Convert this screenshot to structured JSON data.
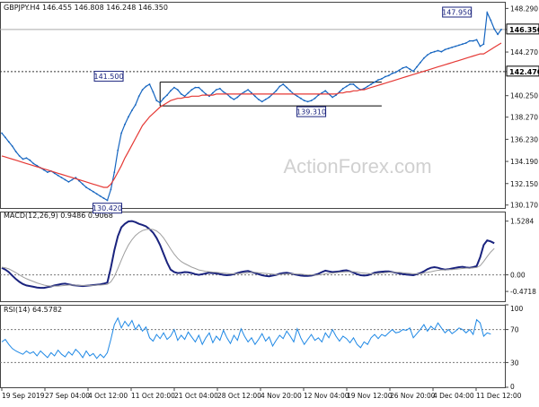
{
  "chart_data": [
    {
      "type": "line",
      "panel": "price",
      "header": "GBPJPY.H4  146.455 146.808 146.248 146.350",
      "x_ticks": [
        "19 Sep 2019",
        "27 Sep 04:00",
        "4 Oct 12:00",
        "11 Oct 20:00",
        "21 Oct 04:00",
        "28 Oct 12:00",
        "4 Nov 20:00",
        "12 Nov 04:00",
        "19 Nov 12:00",
        "26 Nov 20:00",
        "4 Dec 04:00",
        "11 Dec 12:00"
      ],
      "y_ticks": [
        130.17,
        132.15,
        134.19,
        136.23,
        138.27,
        140.25,
        142.47,
        144.27,
        146.35,
        148.29
      ],
      "ylim": [
        129.9,
        148.9
      ],
      "grid": false,
      "watermark": "ActionForex.com",
      "annotations": [
        {
          "text": "141.500",
          "x_index": 35,
          "value": 141.5
        },
        {
          "text": "130.420",
          "x_index": 30,
          "value": 130.42
        },
        {
          "text": "139.310",
          "x_index": 88,
          "value": 139.31
        },
        {
          "text": "147.950",
          "x_index": 134,
          "value": 147.95
        }
      ],
      "horizontal_lines": [
        {
          "name": "current",
          "value": 146.35,
          "label": "146.350",
          "style": "solid-gray"
        },
        {
          "name": "level",
          "value": 142.47,
          "label": "142.470",
          "style": "dotted"
        }
      ],
      "range_box": {
        "from_index": 45,
        "to_index": 108,
        "top": 141.5,
        "bottom": 139.31
      },
      "series": [
        {
          "name": "price",
          "color": "#1565c0",
          "values": [
            136.8,
            136.4,
            136.0,
            135.6,
            135.1,
            134.7,
            134.4,
            134.5,
            134.3,
            134.0,
            133.8,
            133.6,
            133.4,
            133.2,
            133.3,
            133.1,
            132.9,
            132.7,
            132.5,
            132.3,
            132.5,
            132.7,
            132.4,
            132.1,
            131.8,
            131.6,
            131.4,
            131.2,
            131.0,
            130.8,
            130.6,
            131.6,
            133.2,
            135.2,
            136.8,
            137.6,
            138.3,
            138.9,
            139.4,
            140.2,
            140.8,
            141.1,
            141.3,
            140.6,
            139.8,
            139.6,
            140.0,
            140.3,
            140.7,
            141.0,
            140.8,
            140.4,
            140.2,
            140.5,
            140.8,
            141.0,
            141.0,
            140.7,
            140.4,
            140.2,
            140.5,
            140.8,
            140.9,
            140.6,
            140.4,
            140.1,
            139.9,
            140.1,
            140.4,
            140.6,
            140.8,
            140.5,
            140.2,
            139.9,
            139.7,
            139.9,
            140.1,
            140.4,
            140.7,
            141.1,
            141.3,
            141.0,
            140.7,
            140.4,
            140.2,
            140.0,
            139.8,
            139.7,
            139.8,
            140.0,
            140.3,
            140.5,
            140.7,
            140.4,
            140.1,
            140.3,
            140.6,
            140.9,
            141.1,
            141.3,
            141.3,
            141.0,
            140.8,
            140.9,
            141.1,
            141.3,
            141.5,
            141.7,
            141.8,
            142.0,
            142.1,
            142.3,
            142.4,
            142.6,
            142.8,
            142.9,
            142.7,
            142.5,
            142.9,
            143.3,
            143.7,
            144.0,
            144.2,
            144.3,
            144.4,
            144.3,
            144.5,
            144.6,
            144.7,
            144.8,
            144.9,
            145.0,
            145.1,
            145.3,
            145.3,
            145.4,
            144.8,
            145.0,
            147.9,
            147.2,
            146.4,
            145.9,
            146.35
          ]
        },
        {
          "name": "sma",
          "color": "#e53935",
          "values": [
            134.7,
            134.6,
            134.5,
            134.4,
            134.3,
            134.2,
            134.1,
            134.0,
            133.9,
            133.8,
            133.7,
            133.6,
            133.5,
            133.4,
            133.3,
            133.2,
            133.1,
            133.0,
            132.9,
            132.8,
            132.7,
            132.6,
            132.5,
            132.4,
            132.3,
            132.2,
            132.1,
            132.0,
            131.9,
            131.8,
            131.8,
            132.1,
            132.6,
            133.2,
            133.8,
            134.5,
            135.1,
            135.7,
            136.3,
            136.9,
            137.5,
            137.9,
            138.3,
            138.6,
            138.9,
            139.2,
            139.4,
            139.6,
            139.8,
            139.9,
            140.0,
            140.0,
            140.1,
            140.1,
            140.2,
            140.2,
            140.2,
            140.3,
            140.3,
            140.3,
            140.3,
            140.4,
            140.4,
            140.4,
            140.4,
            140.4,
            140.4,
            140.4,
            140.4,
            140.4,
            140.4,
            140.4,
            140.4,
            140.4,
            140.4,
            140.4,
            140.4,
            140.4,
            140.4,
            140.4,
            140.4,
            140.4,
            140.4,
            140.4,
            140.4,
            140.4,
            140.4,
            140.4,
            140.4,
            140.4,
            140.4,
            140.4,
            140.4,
            140.4,
            140.4,
            140.4,
            140.5,
            140.5,
            140.6,
            140.6,
            140.7,
            140.7,
            140.8,
            140.8,
            140.9,
            141.0,
            141.1,
            141.2,
            141.3,
            141.4,
            141.5,
            141.6,
            141.7,
            141.8,
            141.9,
            142.0,
            142.1,
            142.2,
            142.3,
            142.4,
            142.5,
            142.6,
            142.7,
            142.8,
            142.9,
            143.0,
            143.1,
            143.2,
            143.3,
            143.4,
            143.5,
            143.6,
            143.7,
            143.8,
            143.9,
            144.0,
            144.1,
            144.1,
            144.3,
            144.5,
            144.7,
            144.9,
            145.1
          ]
        }
      ]
    },
    {
      "type": "line",
      "panel": "macd",
      "header": "MACD(12,26,9) 0.9486 0.9068",
      "y_ticks": [
        1.5284,
        0.0,
        -0.4718
      ],
      "y_tick_labels": [
        "1.5284",
        "0.00",
        "-0.4718"
      ],
      "ylim": [
        -0.75,
        1.8
      ],
      "reference_lines": [
        0.0
      ],
      "grid": false,
      "series": [
        {
          "name": "macd",
          "color": "#1a237e",
          "values": [
            0.2,
            0.15,
            0.08,
            -0.02,
            -0.12,
            -0.2,
            -0.26,
            -0.3,
            -0.32,
            -0.34,
            -0.36,
            -0.37,
            -0.37,
            -0.35,
            -0.33,
            -0.3,
            -0.28,
            -0.26,
            -0.25,
            -0.27,
            -0.29,
            -0.3,
            -0.31,
            -0.32,
            -0.31,
            -0.3,
            -0.29,
            -0.28,
            -0.27,
            -0.25,
            -0.22,
            0.2,
            0.7,
            1.1,
            1.35,
            1.45,
            1.52,
            1.53,
            1.5,
            1.45,
            1.42,
            1.38,
            1.3,
            1.2,
            1.05,
            0.85,
            0.6,
            0.35,
            0.15,
            0.08,
            0.05,
            0.06,
            0.08,
            0.07,
            0.05,
            0.02,
            0.0,
            0.02,
            0.04,
            0.06,
            0.05,
            0.04,
            0.02,
            0.0,
            -0.01,
            0.0,
            0.02,
            0.05,
            0.08,
            0.1,
            0.11,
            0.08,
            0.05,
            0.02,
            -0.01,
            -0.03,
            -0.04,
            -0.02,
            0.0,
            0.03,
            0.05,
            0.06,
            0.04,
            0.02,
            0.0,
            -0.02,
            -0.03,
            -0.03,
            -0.02,
            0.0,
            0.03,
            0.08,
            0.12,
            0.1,
            0.08,
            0.09,
            0.1,
            0.12,
            0.13,
            0.1,
            0.06,
            0.02,
            -0.01,
            -0.02,
            -0.01,
            0.02,
            0.06,
            0.08,
            0.09,
            0.1,
            0.1,
            0.08,
            0.06,
            0.04,
            0.02,
            0.01,
            0.0,
            -0.01,
            0.02,
            0.05,
            0.1,
            0.16,
            0.2,
            0.22,
            0.2,
            0.17,
            0.15,
            0.16,
            0.18,
            0.2,
            0.22,
            0.23,
            0.21,
            0.2,
            0.22,
            0.25,
            0.5,
            0.85,
            0.98,
            0.95,
            0.9
          ]
        },
        {
          "name": "signal",
          "color": "#9e9e9e",
          "values": [
            0.22,
            0.2,
            0.17,
            0.12,
            0.06,
            0.0,
            -0.06,
            -0.11,
            -0.15,
            -0.19,
            -0.23,
            -0.26,
            -0.29,
            -0.31,
            -0.32,
            -0.32,
            -0.32,
            -0.31,
            -0.3,
            -0.29,
            -0.29,
            -0.29,
            -0.3,
            -0.3,
            -0.3,
            -0.3,
            -0.3,
            -0.29,
            -0.29,
            -0.28,
            -0.27,
            -0.2,
            -0.05,
            0.18,
            0.42,
            0.65,
            0.85,
            1.0,
            1.12,
            1.2,
            1.26,
            1.29,
            1.3,
            1.29,
            1.25,
            1.17,
            1.05,
            0.9,
            0.74,
            0.59,
            0.47,
            0.38,
            0.32,
            0.27,
            0.22,
            0.18,
            0.14,
            0.12,
            0.1,
            0.09,
            0.08,
            0.07,
            0.06,
            0.05,
            0.04,
            0.03,
            0.03,
            0.03,
            0.04,
            0.05,
            0.06,
            0.07,
            0.07,
            0.06,
            0.05,
            0.04,
            0.03,
            0.02,
            0.01,
            0.01,
            0.02,
            0.02,
            0.03,
            0.03,
            0.02,
            0.02,
            0.01,
            0.0,
            0.0,
            -0.01,
            0.0,
            0.01,
            0.03,
            0.04,
            0.05,
            0.06,
            0.07,
            0.08,
            0.09,
            0.09,
            0.09,
            0.08,
            0.06,
            0.05,
            0.04,
            0.03,
            0.03,
            0.04,
            0.05,
            0.06,
            0.07,
            0.07,
            0.07,
            0.07,
            0.06,
            0.05,
            0.04,
            0.03,
            0.03,
            0.03,
            0.05,
            0.07,
            0.09,
            0.11,
            0.13,
            0.14,
            0.14,
            0.15,
            0.15,
            0.16,
            0.17,
            0.18,
            0.19,
            0.19,
            0.2,
            0.21,
            0.26,
            0.38,
            0.52,
            0.65,
            0.75
          ]
        }
      ]
    },
    {
      "type": "line",
      "panel": "rsi",
      "header": "RSI(14) 64.5782",
      "y_ticks": [
        100,
        70,
        30,
        0
      ],
      "ylim": [
        0,
        100
      ],
      "reference_lines": [
        70,
        30
      ],
      "grid": false,
      "series": [
        {
          "name": "rsi",
          "color": "#1e88e5",
          "values": [
            55,
            58,
            52,
            47,
            44,
            42,
            40,
            44,
            41,
            43,
            38,
            44,
            40,
            36,
            42,
            38,
            45,
            40,
            37,
            43,
            39,
            46,
            42,
            36,
            44,
            38,
            41,
            35,
            40,
            36,
            42,
            58,
            76,
            84,
            72,
            80,
            74,
            81,
            70,
            76,
            68,
            73,
            60,
            56,
            64,
            59,
            66,
            58,
            62,
            70,
            57,
            63,
            58,
            67,
            61,
            55,
            63,
            52,
            60,
            66,
            54,
            62,
            57,
            69,
            60,
            53,
            63,
            57,
            71,
            62,
            55,
            60,
            52,
            58,
            65,
            56,
            61,
            50,
            57,
            63,
            59,
            68,
            62,
            55,
            71,
            60,
            52,
            58,
            64,
            57,
            60,
            55,
            66,
            60,
            70,
            62,
            56,
            62,
            59,
            54,
            60,
            52,
            48,
            55,
            52,
            60,
            64,
            59,
            64,
            62,
            66,
            70,
            66,
            67,
            70,
            69,
            72,
            60,
            65,
            70,
            76,
            68,
            74,
            70,
            78,
            72,
            66,
            70,
            65,
            68,
            72,
            70,
            66,
            70,
            64,
            82,
            78,
            62,
            66,
            64.6
          ]
        }
      ]
    }
  ]
}
